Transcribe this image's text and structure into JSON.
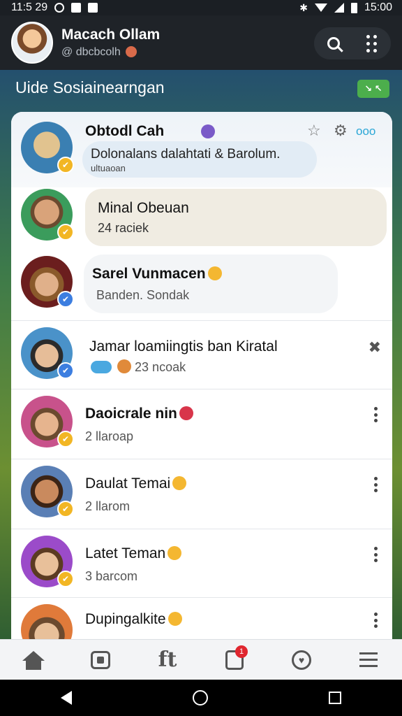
{
  "status_bar": {
    "time_left": "11:5 29",
    "time_right": "15:00"
  },
  "header": {
    "name": "Macach Ollam",
    "handle": "@ dbcbcolh"
  },
  "section": {
    "title": "Uide Sosiainearngan",
    "badge": "↘ ↖"
  },
  "items": [
    {
      "name": "Obtodl Cah",
      "message": "Dolonalans dalahtati & Barolum.",
      "meta": "ultuaoan",
      "actions": "ooo",
      "avatar_colors": [
        "#3a7fb2",
        "#e1c38f"
      ],
      "badge_color": "#f2b624"
    },
    {
      "name": "Minal Obeuan",
      "sub": "24 raciek",
      "avatar_colors": [
        "#3b9c5c",
        "#6b4a2f"
      ],
      "badge_color": "#f2b624"
    },
    {
      "name": "Sarel Vunmacen",
      "sub": "Banden. Sondak",
      "avatar_colors": [
        "#6b1e1e",
        "#8a5a2b"
      ],
      "badge_color": "#3c7ee0"
    },
    {
      "name": "Jamar loamiingtis ban Kiratal",
      "sub": "23 ncoak",
      "avatar_colors": [
        "#4a92c9",
        "#2b2b2b"
      ],
      "badge_color": "#3c7ee0"
    },
    {
      "name": "Daoicrale nin",
      "sub": "2 llaroap",
      "avatar_colors": [
        "#c8528b",
        "#6b4a2f"
      ],
      "badge_color": "#f2b624"
    },
    {
      "name": "Daulat Temai",
      "sub": "2 llarom",
      "avatar_colors": [
        "#5a7fb5",
        "#3b2416"
      ],
      "badge_color": "#f2b624"
    },
    {
      "name": "Latet Teman",
      "sub": "3 barcom",
      "avatar_colors": [
        "#9b4bc9",
        "#5b3b22"
      ],
      "badge_color": "#f2b624"
    },
    {
      "name": "Dupingalkite",
      "sub": "",
      "avatar_colors": [
        "#e07a3a",
        "#6b4a2f"
      ],
      "badge_color": "#f2b624"
    }
  ],
  "nav": {
    "notif_count": "1"
  }
}
